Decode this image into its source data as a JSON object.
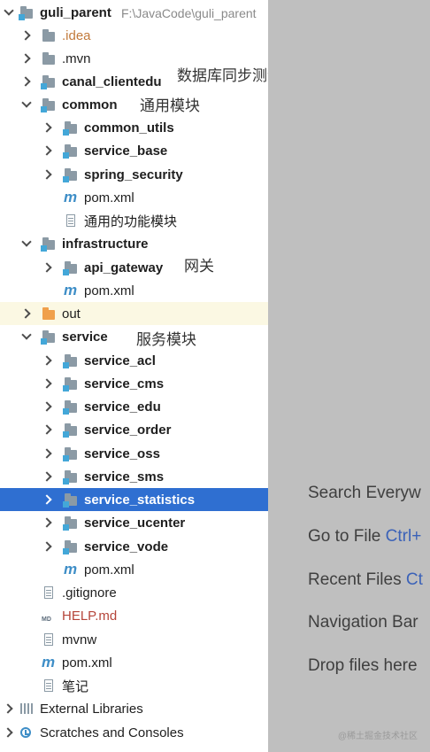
{
  "tree": {
    "root": {
      "label": "guli_parent",
      "path": "F:\\JavaCode\\guli_parent"
    },
    "items": [
      {
        "label": ".idea"
      },
      {
        "label": ".mvn"
      },
      {
        "label": "canal_clientedu"
      },
      {
        "label": "common"
      },
      {
        "label": "common_utils"
      },
      {
        "label": "service_base"
      },
      {
        "label": "spring_security"
      },
      {
        "label": "pom.xml"
      },
      {
        "label": "通用的功能模块"
      },
      {
        "label": "infrastructure"
      },
      {
        "label": "api_gateway"
      },
      {
        "label": "pom.xml"
      },
      {
        "label": "out"
      },
      {
        "label": "service"
      },
      {
        "label": "service_acl"
      },
      {
        "label": "service_cms"
      },
      {
        "label": "service_edu"
      },
      {
        "label": "service_order"
      },
      {
        "label": "service_oss"
      },
      {
        "label": "service_sms"
      },
      {
        "label": "service_statistics"
      },
      {
        "label": "service_ucenter"
      },
      {
        "label": "service_vode"
      },
      {
        "label": "pom.xml"
      },
      {
        "label": ".gitignore"
      },
      {
        "label": "HELP.md"
      },
      {
        "label": "mvnw"
      },
      {
        "label": "pom.xml"
      },
      {
        "label": "笔记"
      },
      {
        "label": "External Libraries"
      },
      {
        "label": "Scratches and Consoles"
      }
    ]
  },
  "annotations": {
    "canal": "数据库同步测试模块",
    "common": "通用模块",
    "gateway": "网关",
    "service": "服务模块"
  },
  "editor_hints": [
    {
      "text": "Search Everyw",
      "key": ""
    },
    {
      "text": "Go to File ",
      "key": "Ctrl+"
    },
    {
      "text": "Recent Files ",
      "key": "Ct"
    },
    {
      "text": "Navigation Bar",
      "key": ""
    },
    {
      "text": "Drop files here",
      "key": ""
    }
  ],
  "watermark": "@稀土掘金技术社区",
  "colors": {
    "selection": "#2f6fd1",
    "module_marker": "#43a7d8",
    "out_folder": "#f0a04b",
    "right_pane": "#bfbfbf"
  }
}
